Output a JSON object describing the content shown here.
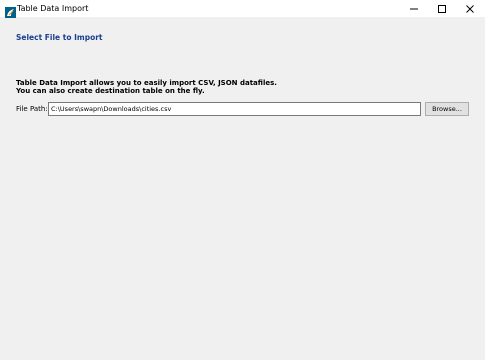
{
  "window": {
    "title": "Table Data Import",
    "icon": "workbench-dolphin-icon"
  },
  "controls": {
    "minimize": "minimize-icon",
    "maximize": "maximize-icon",
    "close": "close-icon"
  },
  "page": {
    "section_title": "Select File to Import",
    "description_line1": "Table Data Import allows you to easily import CSV, JSON datafiles.",
    "description_line2": "You can also create destination table on the fly."
  },
  "file_path": {
    "label": "File Path:",
    "value": "C:\\Users\\swapn\\Downloads\\cities.csv",
    "browse_label": "Browse..."
  },
  "colors": {
    "accent_title": "#1a3f8f",
    "background": "#f0f0f0"
  }
}
